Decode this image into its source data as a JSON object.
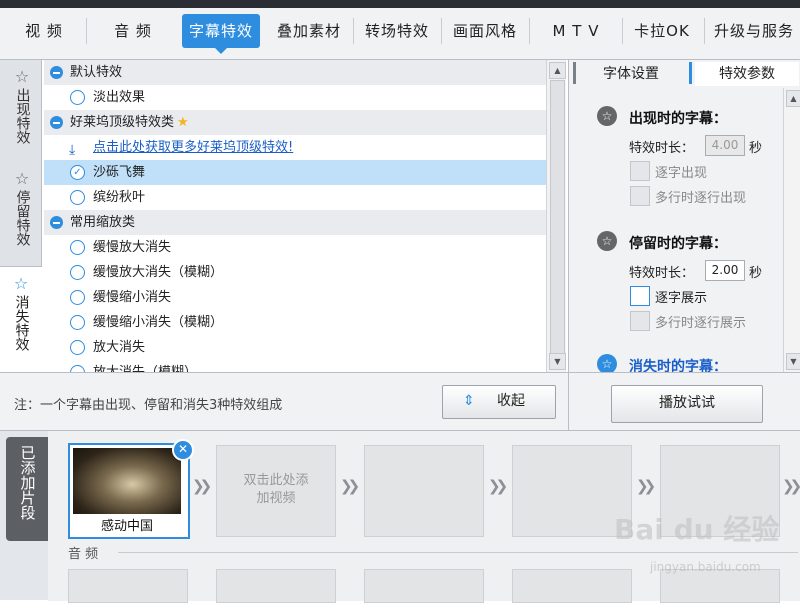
{
  "top_tabs": [
    {
      "label": "视  频"
    },
    {
      "label": "音  频"
    },
    {
      "label": "字幕特效"
    },
    {
      "label": "叠加素材"
    },
    {
      "label": "转场特效"
    },
    {
      "label": "画面风格"
    },
    {
      "label": "M T V"
    },
    {
      "label": "卡拉OK"
    },
    {
      "label": "升级与服务"
    }
  ],
  "active_top_tab": "字幕特效",
  "side_tabs": [
    {
      "label": "出现特效",
      "icon": "star-outline-icon"
    },
    {
      "label": "停留特效",
      "icon": "star-outline-icon"
    },
    {
      "label": "消失特效",
      "icon": "star-outline-icon"
    }
  ],
  "active_side_tab": "消失特效",
  "effect_list": {
    "group_default": "默认特效",
    "item_fade": "淡出效果",
    "group_hollywood": "好莱坞顶级特效类",
    "link_more": "点击此处获取更多好莱坞顶级特效!",
    "item_sand": "沙砾飞舞",
    "item_leaves": "缤纷秋叶",
    "group_zoom": "常用缩放类",
    "item_slow_zoom_in": "缓慢放大消失",
    "item_slow_zoom_in_blur": "缓慢放大消失（模糊）",
    "item_slow_zoom_out": "缓慢缩小消失",
    "item_slow_zoom_out_blur": "缓慢缩小消失（模糊）",
    "item_zoom_in": "放大消失",
    "item_zoom_in_blur_partial": "放大消失（模糊）",
    "selected": "沙砾飞舞"
  },
  "right_panel": {
    "tab_font": "字体设置",
    "tab_effect": "特效参数",
    "appear_heading": "出现时的字幕：",
    "stay_heading": "停留时的字幕：",
    "disappear_heading": "消失时的字幕：",
    "duration_label": "特效时长：",
    "seconds_unit": "秒",
    "appear_duration": "4.00",
    "stay_duration": "2.00",
    "appear_option1": "逐字出现",
    "appear_option2": "多行时逐行出现",
    "stay_option1": "逐字展示",
    "stay_option2": "多行时逐行展示"
  },
  "note": "注：一个字幕由出现、停留和消失3种特效组成",
  "collapse_button": "收起",
  "play_button": "播放试试",
  "clips": {
    "section_label": "已添加片段",
    "clip1_title": "感动中国",
    "add_video_text": "双击此处添加视频",
    "audio_label": "音 频"
  },
  "watermark": "Bai du 经验",
  "watermark_sub": "jingyan.baidu.com",
  "colors": {
    "accent": "#2f8de0",
    "selected_row": "#bfe0f8"
  }
}
